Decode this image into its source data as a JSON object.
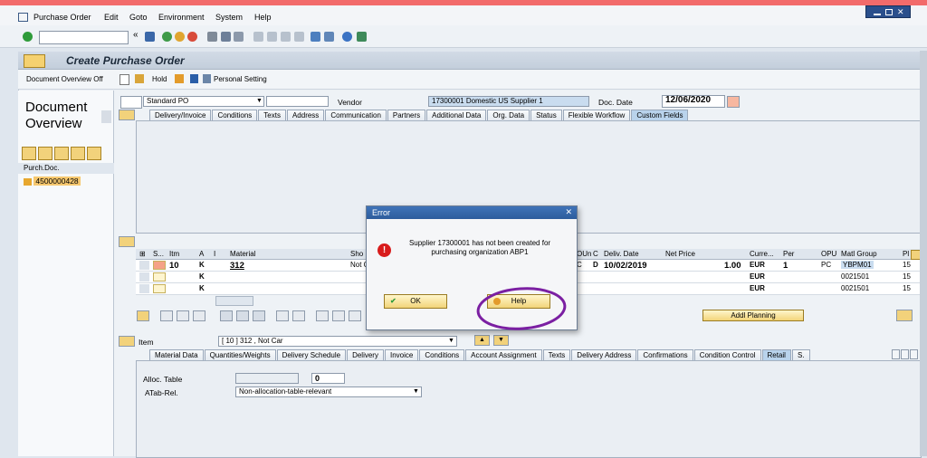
{
  "menu": [
    "Purchase Order",
    "Edit",
    "Goto",
    "Environment",
    "System",
    "Help"
  ],
  "title": "Create Purchase Order",
  "app_toolbar": {
    "doc_overview": "Document Overview Off",
    "hold": "Hold",
    "personal": "Personal Setting"
  },
  "left_panel": {
    "title": "Document Overview",
    "col_header": "Purch.Doc.",
    "doc_number": "4500000428"
  },
  "header": {
    "po_type": "Standard PO",
    "vendor_label": "Vendor",
    "vendor_value": "17300001 Domestic US Supplier 1",
    "doc_date_label": "Doc. Date",
    "doc_date_value": "12/06/2020"
  },
  "header_tabs": [
    "Delivery/Invoice",
    "Conditions",
    "Texts",
    "Address",
    "Communication",
    "Partners",
    "Additional Data",
    "Org. Data",
    "Status",
    "Flexible Workflow",
    "Custom Fields"
  ],
  "items_grid": {
    "columns_left": [
      "S...",
      "Itm",
      "A",
      "I",
      "Material",
      "Sho"
    ],
    "columns_right": [
      "OUn",
      "C",
      "Deliv. Date",
      "Net Price",
      "Curre...",
      "Per",
      "OPU",
      "Matl Group",
      "Pl"
    ],
    "rows": [
      {
        "itm": "10",
        "a": "K",
        "material": "312",
        "short": "Not C",
        "oun": "C",
        "c": "D",
        "deliv": "10/02/2019",
        "price": "1.00",
        "curr": "EUR",
        "per": "1",
        "opu": "PC",
        "matl": "YBPM01",
        "pl": "15"
      },
      {
        "itm": "",
        "a": "K",
        "material": "",
        "short": "",
        "oun": "",
        "c": "",
        "deliv": "",
        "price": "",
        "curr": "EUR",
        "per": "",
        "opu": "",
        "matl": "0021501",
        "pl": "15"
      },
      {
        "itm": "",
        "a": "K",
        "material": "",
        "short": "",
        "oun": "",
        "c": "",
        "deliv": "",
        "price": "",
        "curr": "EUR",
        "per": "",
        "opu": "",
        "matl": "0021501",
        "pl": "15"
      }
    ],
    "addl_planning": "Addl Planning"
  },
  "item_detail": {
    "label": "Item",
    "value": "[ 10 ] 312 , Not Car",
    "tabs": [
      "Material Data",
      "Quantities/Weights",
      "Delivery Schedule",
      "Delivery",
      "Invoice",
      "Conditions",
      "Account Assignment",
      "Texts",
      "Delivery Address",
      "Confirmations",
      "Condition Control",
      "Retail",
      "S."
    ],
    "alloc_label": "Alloc. Table",
    "alloc_num": "0",
    "atab_label": "ATab-Rel.",
    "atab_value": "Non-allocation-table-relevant"
  },
  "dialog": {
    "title": "Error",
    "message_line1": "Supplier 17300001 has not been created for",
    "message_line2": "purchasing organization ABP1",
    "ok": "OK",
    "help": "Help"
  },
  "colors": {
    "accent": "#2d5c9c",
    "circle": "#7b1fa2",
    "error": "#d81b1b"
  }
}
